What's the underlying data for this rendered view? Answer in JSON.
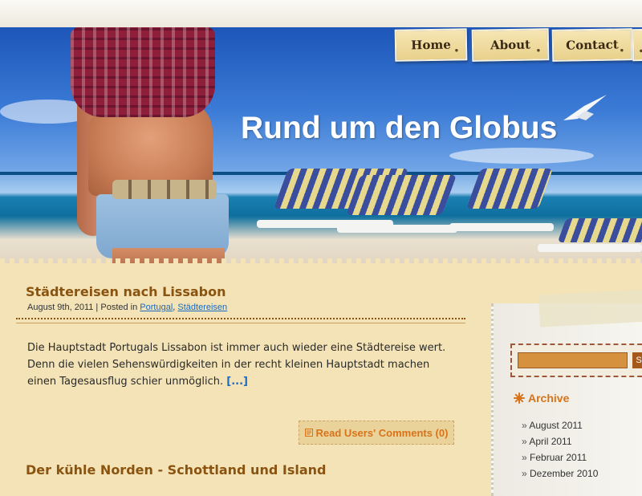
{
  "site": {
    "title": "Rund um den Globus"
  },
  "nav": {
    "items": [
      {
        "label": "Home"
      },
      {
        "label": "About"
      },
      {
        "label": "Contact"
      }
    ]
  },
  "posts": [
    {
      "title": "Städtereisen nach Lissabon",
      "date": "August 9th, 2011",
      "posted_in_label": "Posted in",
      "categories": [
        "Portugal",
        "Städtereisen"
      ],
      "excerpt": "Die Hauptstadt Portugals Lissabon ist immer auch wieder eine Städtereise wert. Denn die vielen Sehenswürdigkeiten in der recht kleinen Hauptstadt machen einen Tagesausflug schier unmöglich.",
      "more_label": "[...]",
      "comments_label": "Read Users' Comments (0)"
    },
    {
      "title": "Der kühle Norden - Schottland und Island"
    }
  ],
  "sidebar": {
    "search": {
      "button_label": "S"
    },
    "archive": {
      "heading": "Archive",
      "items": [
        "August 2011",
        "April 2011",
        "Februar 2011",
        "Dezember 2010"
      ]
    }
  },
  "colors": {
    "accent": "#d8731a",
    "post_title": "#8a5410",
    "link": "#1a6ac0",
    "background": "#f3e3b6"
  },
  "icons": {
    "comments": "comment-icon",
    "archive": "asterisk-icon",
    "search": "search-icon"
  }
}
